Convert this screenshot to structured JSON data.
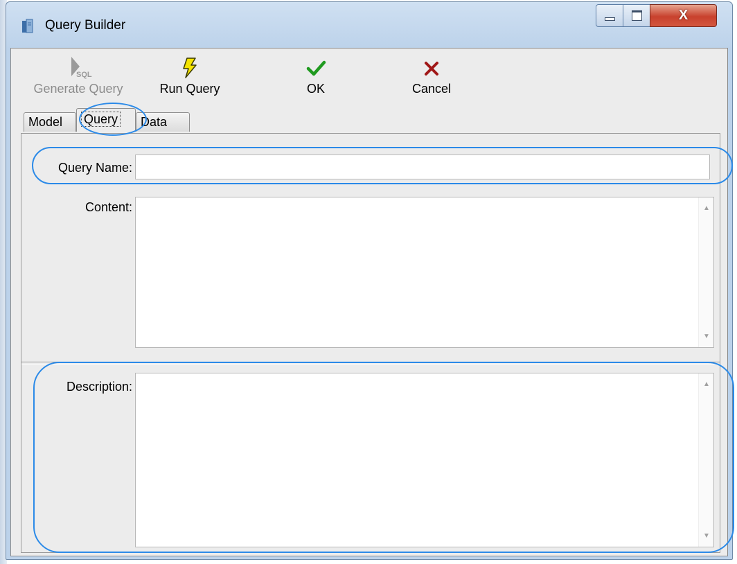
{
  "window": {
    "title": "Query Builder",
    "controls": {
      "minimize": "minimize",
      "maximize": "maximize",
      "close": "X"
    }
  },
  "toolbar": {
    "generate": {
      "label": "Generate Query",
      "icon": "generate-sql-icon",
      "enabled": false
    },
    "run": {
      "label": "Run Query",
      "icon": "lightning-icon"
    },
    "ok": {
      "label": "OK",
      "icon": "checkmark-icon"
    },
    "cancel": {
      "label": "Cancel",
      "icon": "x-mark-icon"
    }
  },
  "tabs": [
    {
      "label": "Model"
    },
    {
      "label": "Query",
      "active": true
    },
    {
      "label": "Data"
    }
  ],
  "form": {
    "query_name": {
      "label": "Query Name:",
      "value": ""
    },
    "content": {
      "label": "Content:",
      "value": ""
    },
    "description": {
      "label": "Description:",
      "value": ""
    }
  },
  "colors": {
    "highlight_ring": "#2b8ae8",
    "ok_green": "#1f9a1f",
    "cancel_red": "#a01818",
    "run_yellow": "#f5e400"
  }
}
